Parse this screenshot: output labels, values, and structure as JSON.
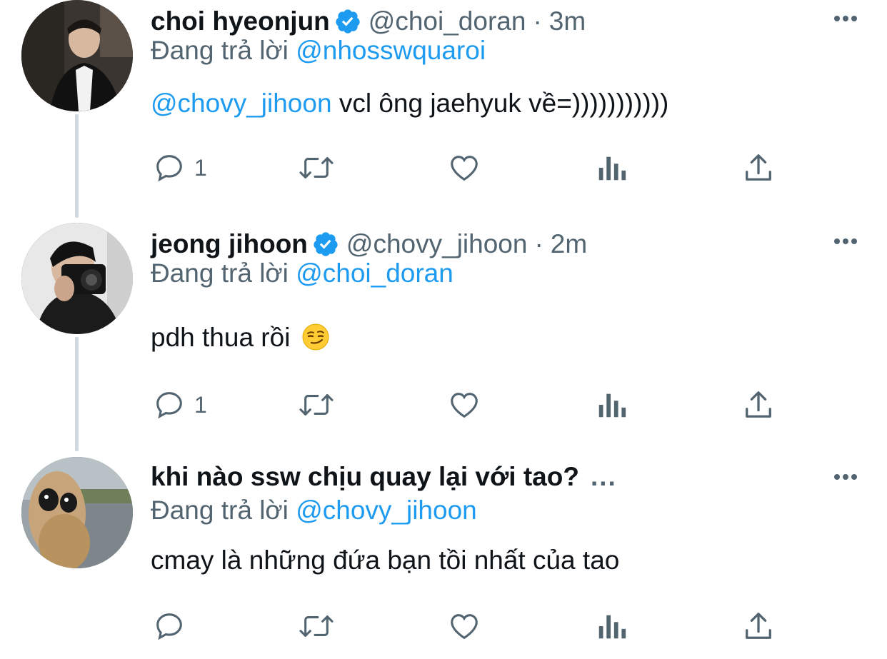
{
  "tweets": [
    {
      "name": "choi hyeonjun",
      "verified": true,
      "handle": "@choi_doran",
      "separator": "·",
      "time": "3m",
      "reply_prefix": "Đang trả lời",
      "reply_to": "@nhosswquaroi",
      "body_mention": "@chovy_jihoon",
      "body_text": " vcl ông jaehyuk về=)))))))))))",
      "reply_count": "1"
    },
    {
      "name": "jeong jihoon",
      "verified": true,
      "handle": "@chovy_jihoon",
      "separator": "·",
      "time": "2m",
      "reply_prefix": "Đang trả lời",
      "reply_to": "@choi_doran",
      "body_text": "pdh thua rồi",
      "body_emoji": "smirking-face",
      "reply_count": "1"
    },
    {
      "name": "khi nào ssw chịu quay lại với tao?",
      "verified": false,
      "truncation": "...",
      "reply_prefix": "Đang trả lời",
      "reply_to": "@chovy_jihoon",
      "body_text": "cmay là những đứa bạn tồi nhất của tao",
      "reply_count": ""
    }
  ],
  "icons": {
    "reply": "reply-icon",
    "retweet": "retweet-icon",
    "like": "like-icon",
    "analytics": "analytics-icon",
    "share": "share-icon",
    "more": "more-icon",
    "verified": "verified-badge-icon"
  },
  "colors": {
    "link": "#1d9bf0",
    "secondary_text": "#536471",
    "primary_text": "#0f1419",
    "thread_line": "#cfd9de"
  }
}
